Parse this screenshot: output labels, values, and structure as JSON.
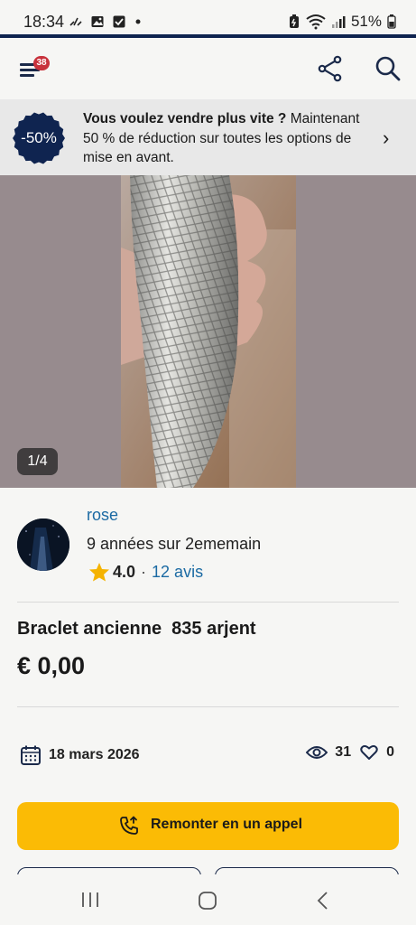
{
  "status_bar": {
    "time": "18:34",
    "battery": "51%"
  },
  "header": {
    "notification_count": "38"
  },
  "promo": {
    "seal_text": "-50%",
    "headline": "Vous voulez vendre plus vite ?",
    "body": " Maintenant 50 % de réduction sur toutes les options de mise en avant.",
    "chevron": "›"
  },
  "photo": {
    "counter": "1/4"
  },
  "seller": {
    "name": "rose",
    "years": "9 années sur 2ememain",
    "rating": "4.0",
    "separator": "·",
    "reviews": "12 avis"
  },
  "listing": {
    "title": "Braclet ancienne  835 arjent",
    "price": "€ 0,00",
    "date": "18 mars 2026",
    "views": "31",
    "likes": "0"
  },
  "cta": {
    "label": "Remonter en un appel"
  },
  "colors": {
    "brand_navy": "#0f2450",
    "badge_red": "#c8323c",
    "link_blue": "#1b6aa3",
    "cta_yellow": "#fbbb05",
    "star": "#f5b301"
  },
  "icons": [
    "menu-icon",
    "share-icon",
    "search-icon",
    "calendar-icon",
    "eye-icon",
    "heart-icon",
    "phone-up-icon",
    "star-icon"
  ]
}
